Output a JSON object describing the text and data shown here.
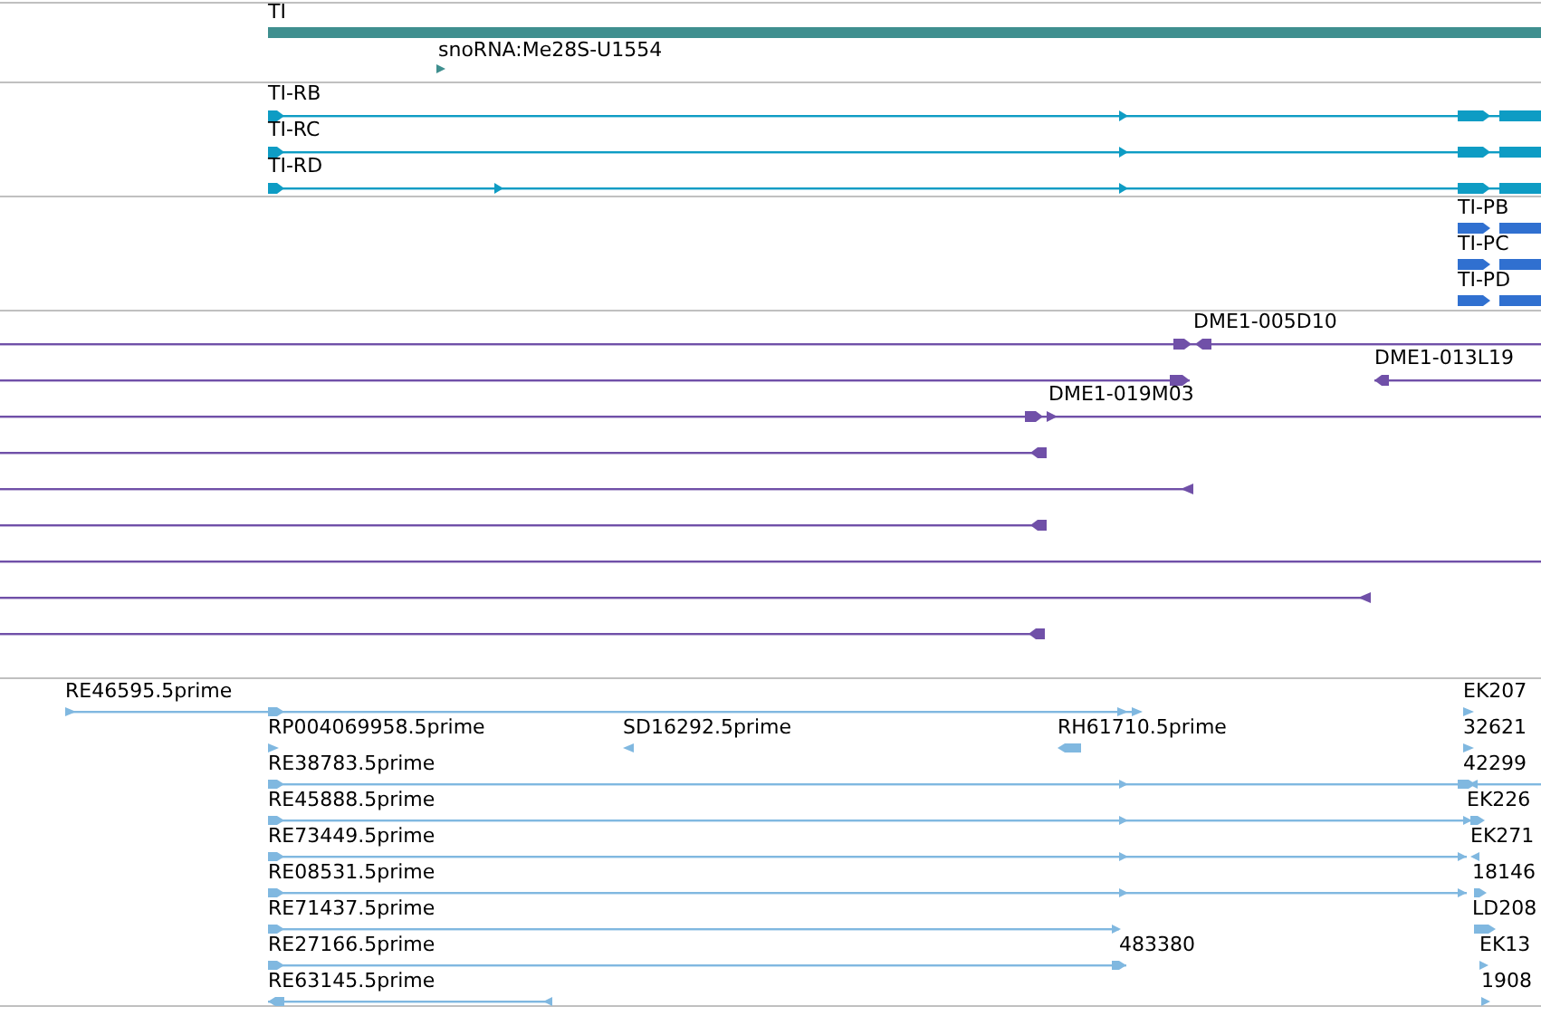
{
  "tracks": [
    {
      "kind": "gene",
      "labels": [
        "TI",
        "snoRNA:Me28S-U1554"
      ]
    },
    {
      "kind": "transcript",
      "labels": [
        "TI-RB",
        "TI-RC",
        "TI-RD"
      ]
    },
    {
      "kind": "protein",
      "labels": [
        "TI-PB",
        "TI-PC",
        "TI-PD"
      ]
    },
    {
      "kind": "clone",
      "labels": [
        "DME1-005D10",
        "DME1-013L19",
        "DME1-019M03"
      ]
    },
    {
      "kind": "est",
      "labels": [
        "RE46595.5prime",
        "EK207",
        "RP004069958.5prime",
        "SD16292.5prime",
        "RH61710.5prime",
        "32621",
        "RE38783.5prime",
        "42299",
        "RE45888.5prime",
        "EK226",
        "RE73449.5prime",
        "EK271",
        "RE08531.5prime",
        "18146",
        "RE71437.5prime",
        "LD208",
        "RE27166.5prime",
        "483380",
        "EK13",
        "RE63145.5prime",
        "1908"
      ]
    }
  ]
}
